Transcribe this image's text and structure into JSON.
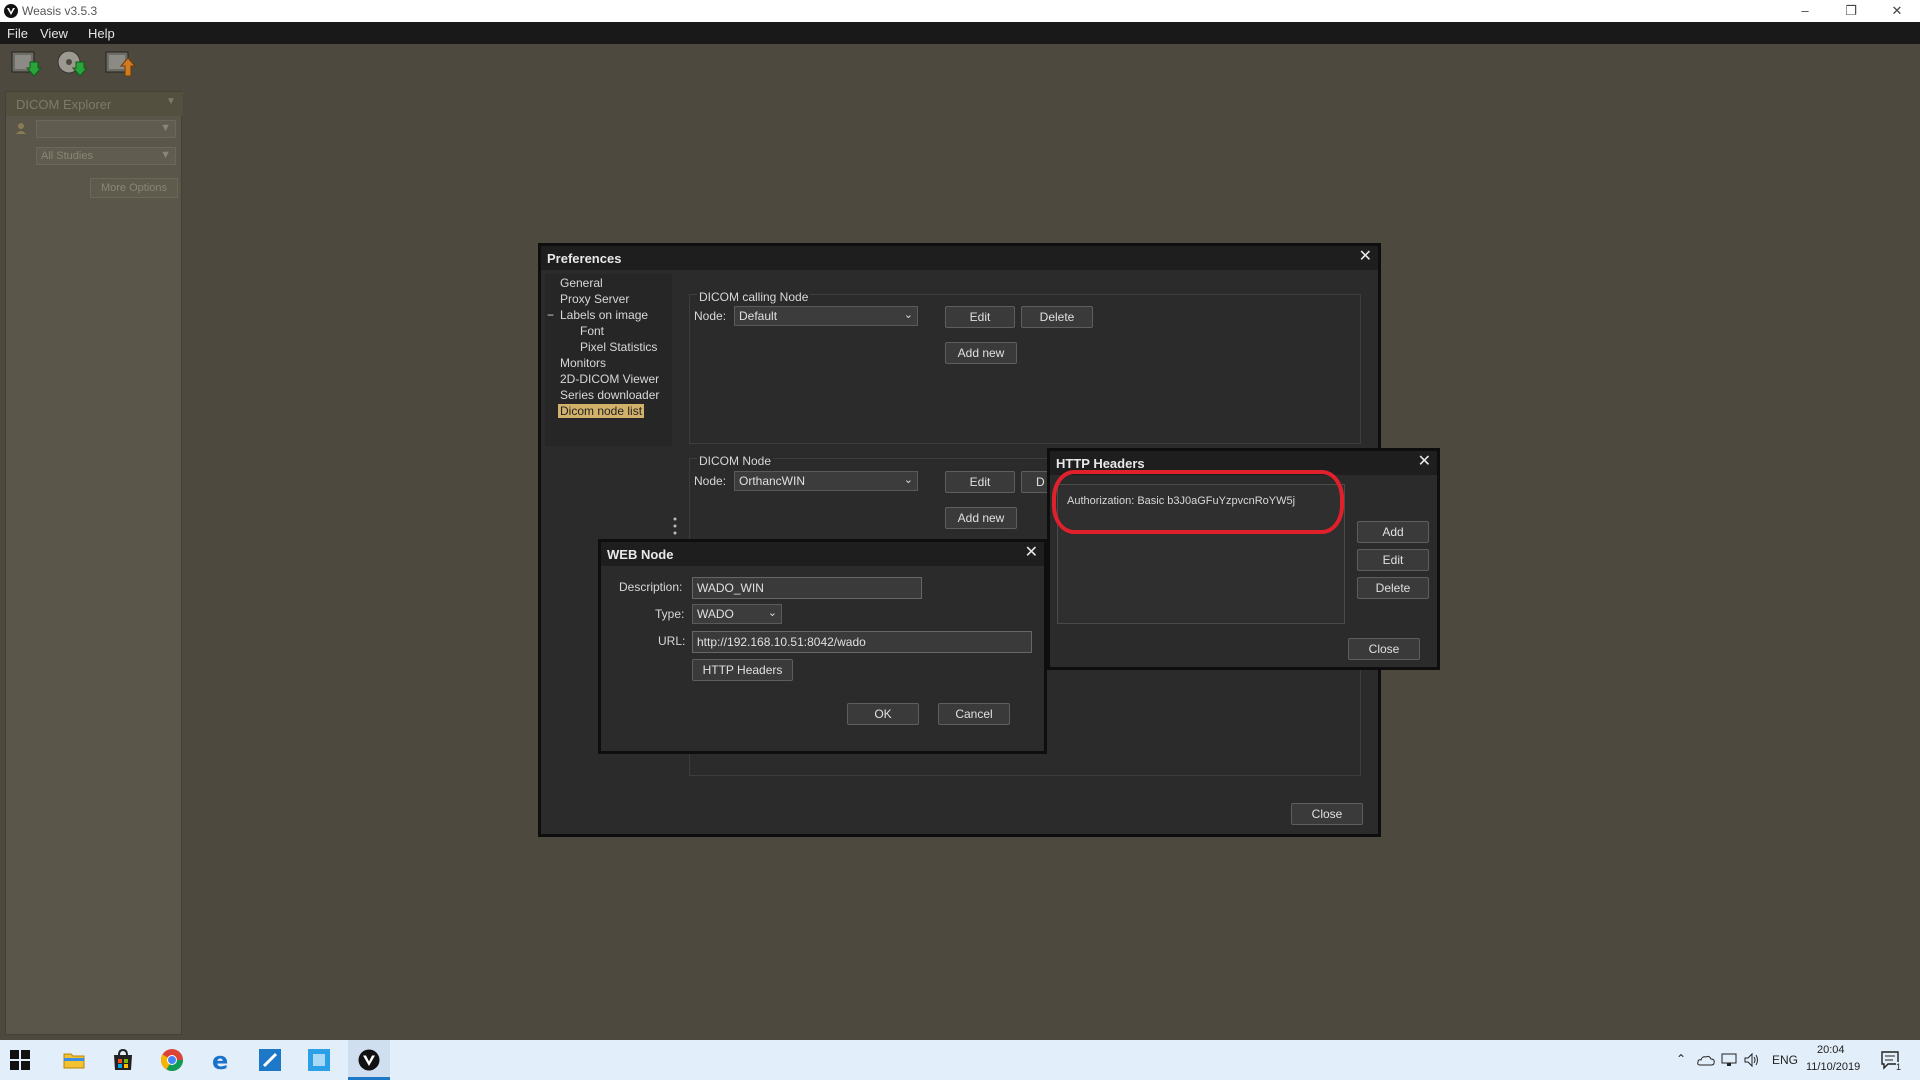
{
  "window": {
    "title": "Weasis v3.5.3"
  },
  "menubar": {
    "items": [
      "File",
      "View",
      "Help"
    ]
  },
  "toolbar": {
    "icons": [
      "import-dicom-icon",
      "import-dicom-cd-icon",
      "export-dicom-icon"
    ]
  },
  "left_panel": {
    "tab_label": "DICOM Explorer",
    "patient_combo": "",
    "studies_combo": "All Studies",
    "more_options": "More Options"
  },
  "preferences": {
    "title": "Preferences",
    "tree": [
      {
        "label": "General",
        "indent": 0
      },
      {
        "label": "Proxy Server",
        "indent": 0
      },
      {
        "label": "Labels on image",
        "indent": 0,
        "expander": "−"
      },
      {
        "label": "Font",
        "indent": 1
      },
      {
        "label": "Pixel Statistics",
        "indent": 1
      },
      {
        "label": "Monitors",
        "indent": 0
      },
      {
        "label": "2D-DICOM Viewer",
        "indent": 0
      },
      {
        "label": "Series downloader",
        "indent": 0
      },
      {
        "label": "Dicom node list",
        "indent": 0,
        "selected": true
      }
    ],
    "calling_node": {
      "group_label": "DICOM calling Node",
      "node_label": "Node:",
      "node_value": "Default",
      "edit": "Edit",
      "delete": "Delete",
      "add_new": "Add new"
    },
    "dicom_node": {
      "group_label": "DICOM Node",
      "node_label": "Node:",
      "node_value": "OrthancWIN",
      "edit": "Edit",
      "delete_partial": "D",
      "add_new": "Add new"
    },
    "close": "Close"
  },
  "web_node": {
    "title": "WEB Node",
    "description_label": "Description:",
    "description_value": "WADO_WIN",
    "type_label": "Type:",
    "type_value": "WADO",
    "url_label": "URL:",
    "url_value": "http://192.168.10.51:8042/wado",
    "http_headers": "HTTP Headers",
    "ok": "OK",
    "cancel": "Cancel"
  },
  "http_headers": {
    "title": "HTTP Headers",
    "entries": [
      "Authorization: Basic b3J0aGFuYzpvcnRoYW5j"
    ],
    "add": "Add",
    "edit": "Edit",
    "delete": "Delete",
    "close": "Close"
  },
  "taskbar": {
    "language": "ENG",
    "time": "20:04",
    "date": "11/10/2019",
    "notification_count": "1"
  }
}
